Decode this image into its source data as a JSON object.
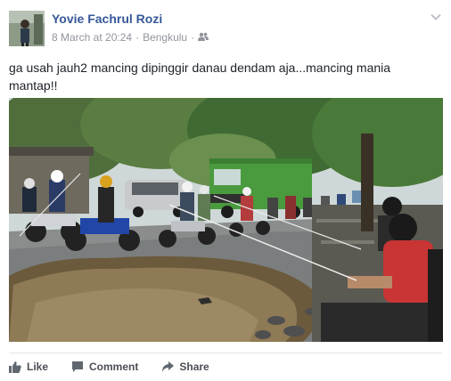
{
  "post": {
    "author": "Yovie Fachrul Rozi",
    "timestamp": "8 March at 20:24",
    "location": "Bengkulu",
    "separator": "·",
    "privacy_icon": "friends-icon",
    "text": "ga usah jauh2 mancing dipinggir danau dendam aja...mancing mania mantap!!"
  },
  "actions": {
    "like": "Like",
    "comment": "Comment",
    "share": "Share"
  },
  "colors": {
    "author_link": "#365899",
    "meta_gray": "#90949c",
    "action_gray": "#4b4f56",
    "truck_green": "#4a9a3e"
  }
}
